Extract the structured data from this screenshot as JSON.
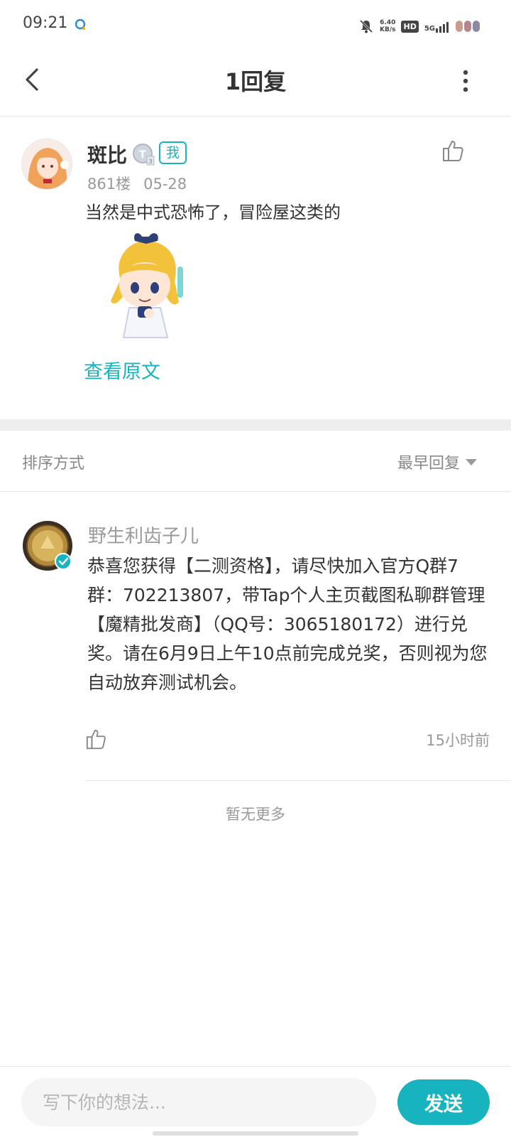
{
  "status_bar": {
    "time": "09:21",
    "net_speed_value": "6.40",
    "net_speed_unit": "KB/s",
    "hd_label": "HD",
    "network_label": "5G"
  },
  "header": {
    "title": "1回复"
  },
  "post": {
    "author": "斑比",
    "level_icon": "T3-level-icon",
    "me_badge": "我",
    "floor": "861楼",
    "date": "05-28",
    "content": "当然是中式恐怖了，冒险屋这类的",
    "view_original": "查看原文"
  },
  "sort": {
    "label": "排序方式",
    "selected": "最早回复"
  },
  "reply": {
    "author": "野生利齿子儿",
    "body": "恭喜您获得【二测资格】，请尽快加入官方Q群7群：702213807，带Tap个人主页截图私聊群管理【魔精批发商】（QQ号：3065180172）进行兑奖。请在6月9日上午10点前完成兑奖，否则视为您自动放弃测试机会。",
    "time": "15小时前"
  },
  "footer": {
    "no_more": "暂无更多"
  },
  "composer": {
    "placeholder": "写下你的想法...",
    "send_label": "发送"
  },
  "colors": {
    "accent": "#17b3bf",
    "muted_text": "#999999",
    "divider": "#e8e8e8"
  }
}
